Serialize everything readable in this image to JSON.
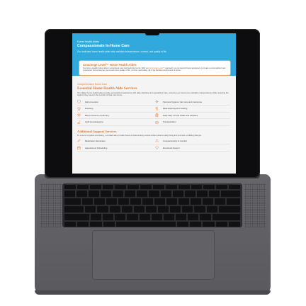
{
  "hero": {
    "eyebrow": "Home Health Aides",
    "title": "Compassionate In-Home Care",
    "subtitle": "Our dedicated home health aides help maintain independence, comfort, and quality of life."
  },
  "concierge": {
    "title": "Concierge Level™ Home Health Aides",
    "body_start": "Our Home Health Aides deliver exceptional care that feels like family. With our ",
    "body_link": "Concierge Level™",
    "body_end": " approach, we go beyond basic assistance to create a personalized care experience that enhances your loved one's quality of life, comfort, and safety, all in the familiar environment of home."
  },
  "comprehensive": {
    "eyebrow": "Comprehensive Home Care",
    "title": "Essential Home Health Aide Services",
    "text": "Our skilled home health aides provide personalized assistance with daily activities and specialized care, ensuring your loved one maintains independence while receiving the support they need in the comfort of their own home.",
    "services": [
      {
        "label": "Fall prevention",
        "icon": "shield-icon"
      },
      {
        "label": "Personal hygiene: hair care and manicures",
        "icon": "sparkle-icon"
      },
      {
        "label": "Dressing",
        "icon": "shirt-icon"
      },
      {
        "label": "Meal planning and cooking",
        "icon": "utensils-icon"
      },
      {
        "label": "Blood pressure monitoring",
        "icon": "heart-pulse-icon"
      },
      {
        "label": "Daily diary of food intake and activities",
        "icon": "clipboard-icon"
      },
      {
        "label": "Light Housekeeping",
        "icon": "broom-icon"
      },
      {
        "label": "Transportation",
        "icon": "car-icon"
      }
    ]
  },
  "additional": {
    "title": "Additional Support Services",
    "text": "To ensure complete well-being, our aides also provide these complementary services that enhance daily living and promote a fulfilling lifestyle.",
    "services": [
      {
        "label": "Medication Reminders",
        "icon": "pill-icon"
      },
      {
        "label": "Companionship & Comfort",
        "icon": "people-icon"
      },
      {
        "label": "Appointment Scheduling",
        "icon": "calendar-icon"
      },
      {
        "label": "Emotional Support",
        "icon": "heart-icon"
      }
    ]
  },
  "colors": {
    "hero": "#31a9dd",
    "accent": "#e8772a",
    "laptop": "#5f5f63"
  }
}
